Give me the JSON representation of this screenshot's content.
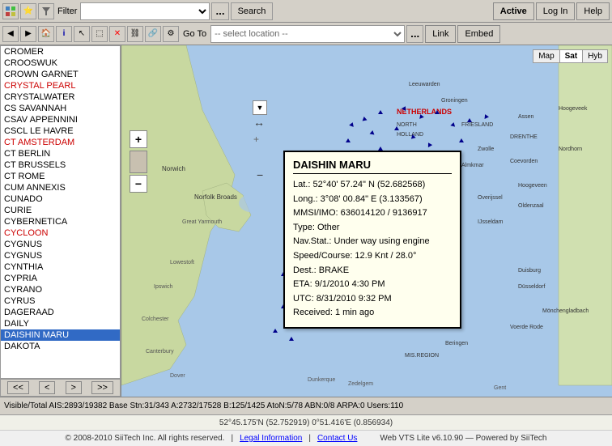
{
  "toolbar1": {
    "filter_label": "Filter",
    "filter_placeholder": "",
    "search_label": "Search",
    "active_label": "Active",
    "login_label": "Log In",
    "help_label": "Help"
  },
  "toolbar2": {
    "goto_label": "Go To",
    "location_placeholder": "-- select location --",
    "link_label": "Link",
    "embed_label": "Embed"
  },
  "sidebar": {
    "items": [
      {
        "label": "CROMER",
        "class": ""
      },
      {
        "label": "CROOSWUK",
        "class": ""
      },
      {
        "label": "CROWN GARNET",
        "class": ""
      },
      {
        "label": "CRYSTAL PEARL",
        "class": "red"
      },
      {
        "label": "CRYSTALWATER",
        "class": ""
      },
      {
        "label": "CS SAVANNAH",
        "class": ""
      },
      {
        "label": "CSAV APPENNINI",
        "class": ""
      },
      {
        "label": "CSCL LE HAVRE",
        "class": ""
      },
      {
        "label": "CT AMSTERDAM",
        "class": "red"
      },
      {
        "label": "CT BERLIN",
        "class": ""
      },
      {
        "label": "CT BRUSSELS",
        "class": ""
      },
      {
        "label": "CT ROME",
        "class": ""
      },
      {
        "label": "CUM ANNEXIS",
        "class": ""
      },
      {
        "label": "CUNADO",
        "class": ""
      },
      {
        "label": "CURIE",
        "class": ""
      },
      {
        "label": "CYBERNETICA",
        "class": ""
      },
      {
        "label": "CYCLOON",
        "class": "red"
      },
      {
        "label": "CYGNUS",
        "class": ""
      },
      {
        "label": "CYGNUS",
        "class": ""
      },
      {
        "label": "CYNTHIA",
        "class": ""
      },
      {
        "label": "CYPRIA",
        "class": ""
      },
      {
        "label": "CYRANO",
        "class": ""
      },
      {
        "label": "CYRUS",
        "class": ""
      },
      {
        "label": "DAGERAAD",
        "class": ""
      },
      {
        "label": "DAILY",
        "class": ""
      },
      {
        "label": "DAISHIN MARU",
        "class": "selected"
      },
      {
        "label": "DAKOTA",
        "class": ""
      }
    ],
    "nav": {
      "first": "<<",
      "prev": "<",
      "next": ">",
      "last": ">>"
    }
  },
  "vessel_popup": {
    "name": "DAISHIN MARU",
    "lat": "Lat.: 52°40' 57.24\" N (52.682568)",
    "long": "Long.: 3°08' 00.84\" E (3.133567)",
    "mmsi": "MMSI/IMO: 636014120 / 9136917",
    "type": "Type: Other",
    "navstat": "Nav.Stat.: Under way using engine",
    "speed": "Speed/Course: 12.9 Knt / 28.0°",
    "dest": "Dest.: BRAKE",
    "eta": "ETA: 9/1/2010 4:30 PM",
    "utc": "UTC: 8/31/2010 9:32 PM",
    "received": "Received: 1 min ago"
  },
  "map_types": [
    "Map",
    "Sat",
    "Hyb"
  ],
  "status": {
    "text": "Visible/Total AIS:2893/19382  Base Stn:31/343  A:2732/17528  B:125/1425  AtoN:5/78  ABN:0/8  ARPA:0  Users:110"
  },
  "footer": {
    "copyright": "© 2008-2010 SiiTech Inc. All rights reserved.",
    "legal": "Legal Information",
    "contact": "Contact Us",
    "powered": "Web VTS Lite v6.10.90",
    "powered_by": "Powered by SiiTech"
  },
  "coordinates": {
    "main": "52°45.175'N (52.752919)   0°51.416'E (0.856934)"
  }
}
